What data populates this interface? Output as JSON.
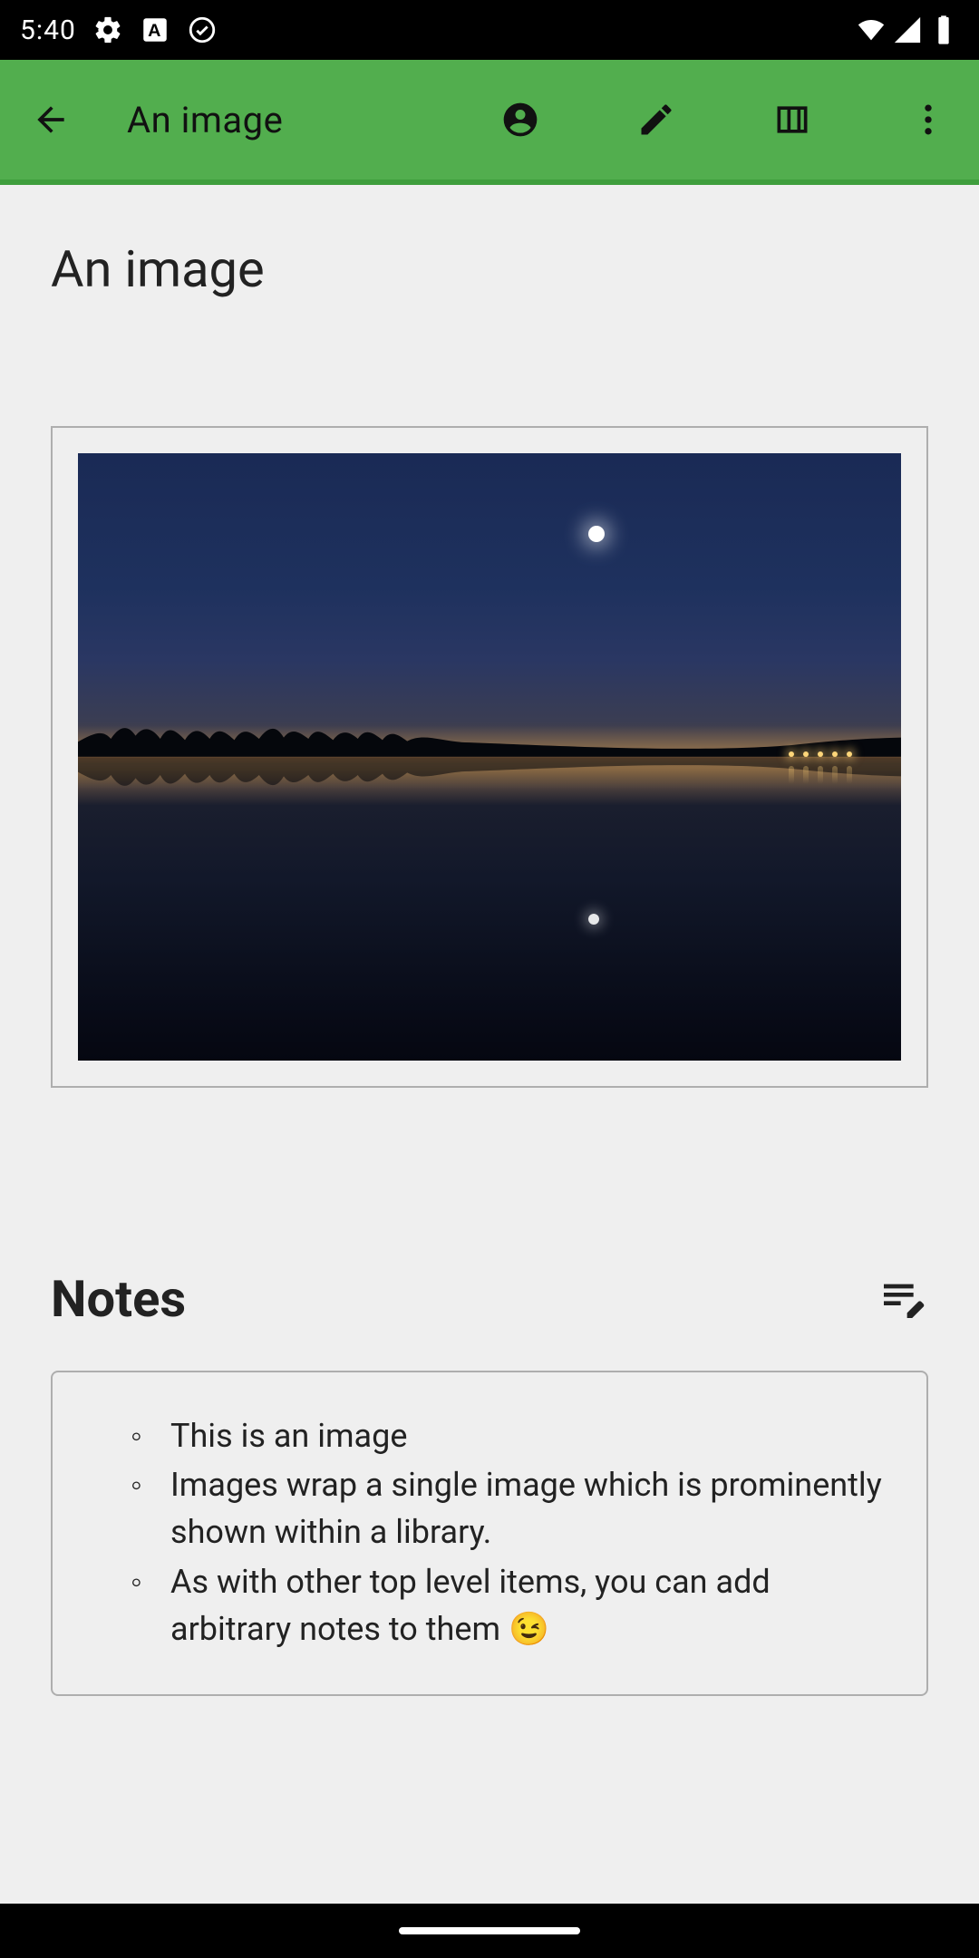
{
  "status": {
    "time": "5:40"
  },
  "appbar": {
    "title": "An image"
  },
  "page": {
    "title": "An image"
  },
  "notes": {
    "heading": "Notes",
    "items": [
      "This is an image",
      "Images wrap a single image which is prominently shown within a library.",
      "As with other top level items, you can add arbitrary notes to them 😉"
    ]
  }
}
